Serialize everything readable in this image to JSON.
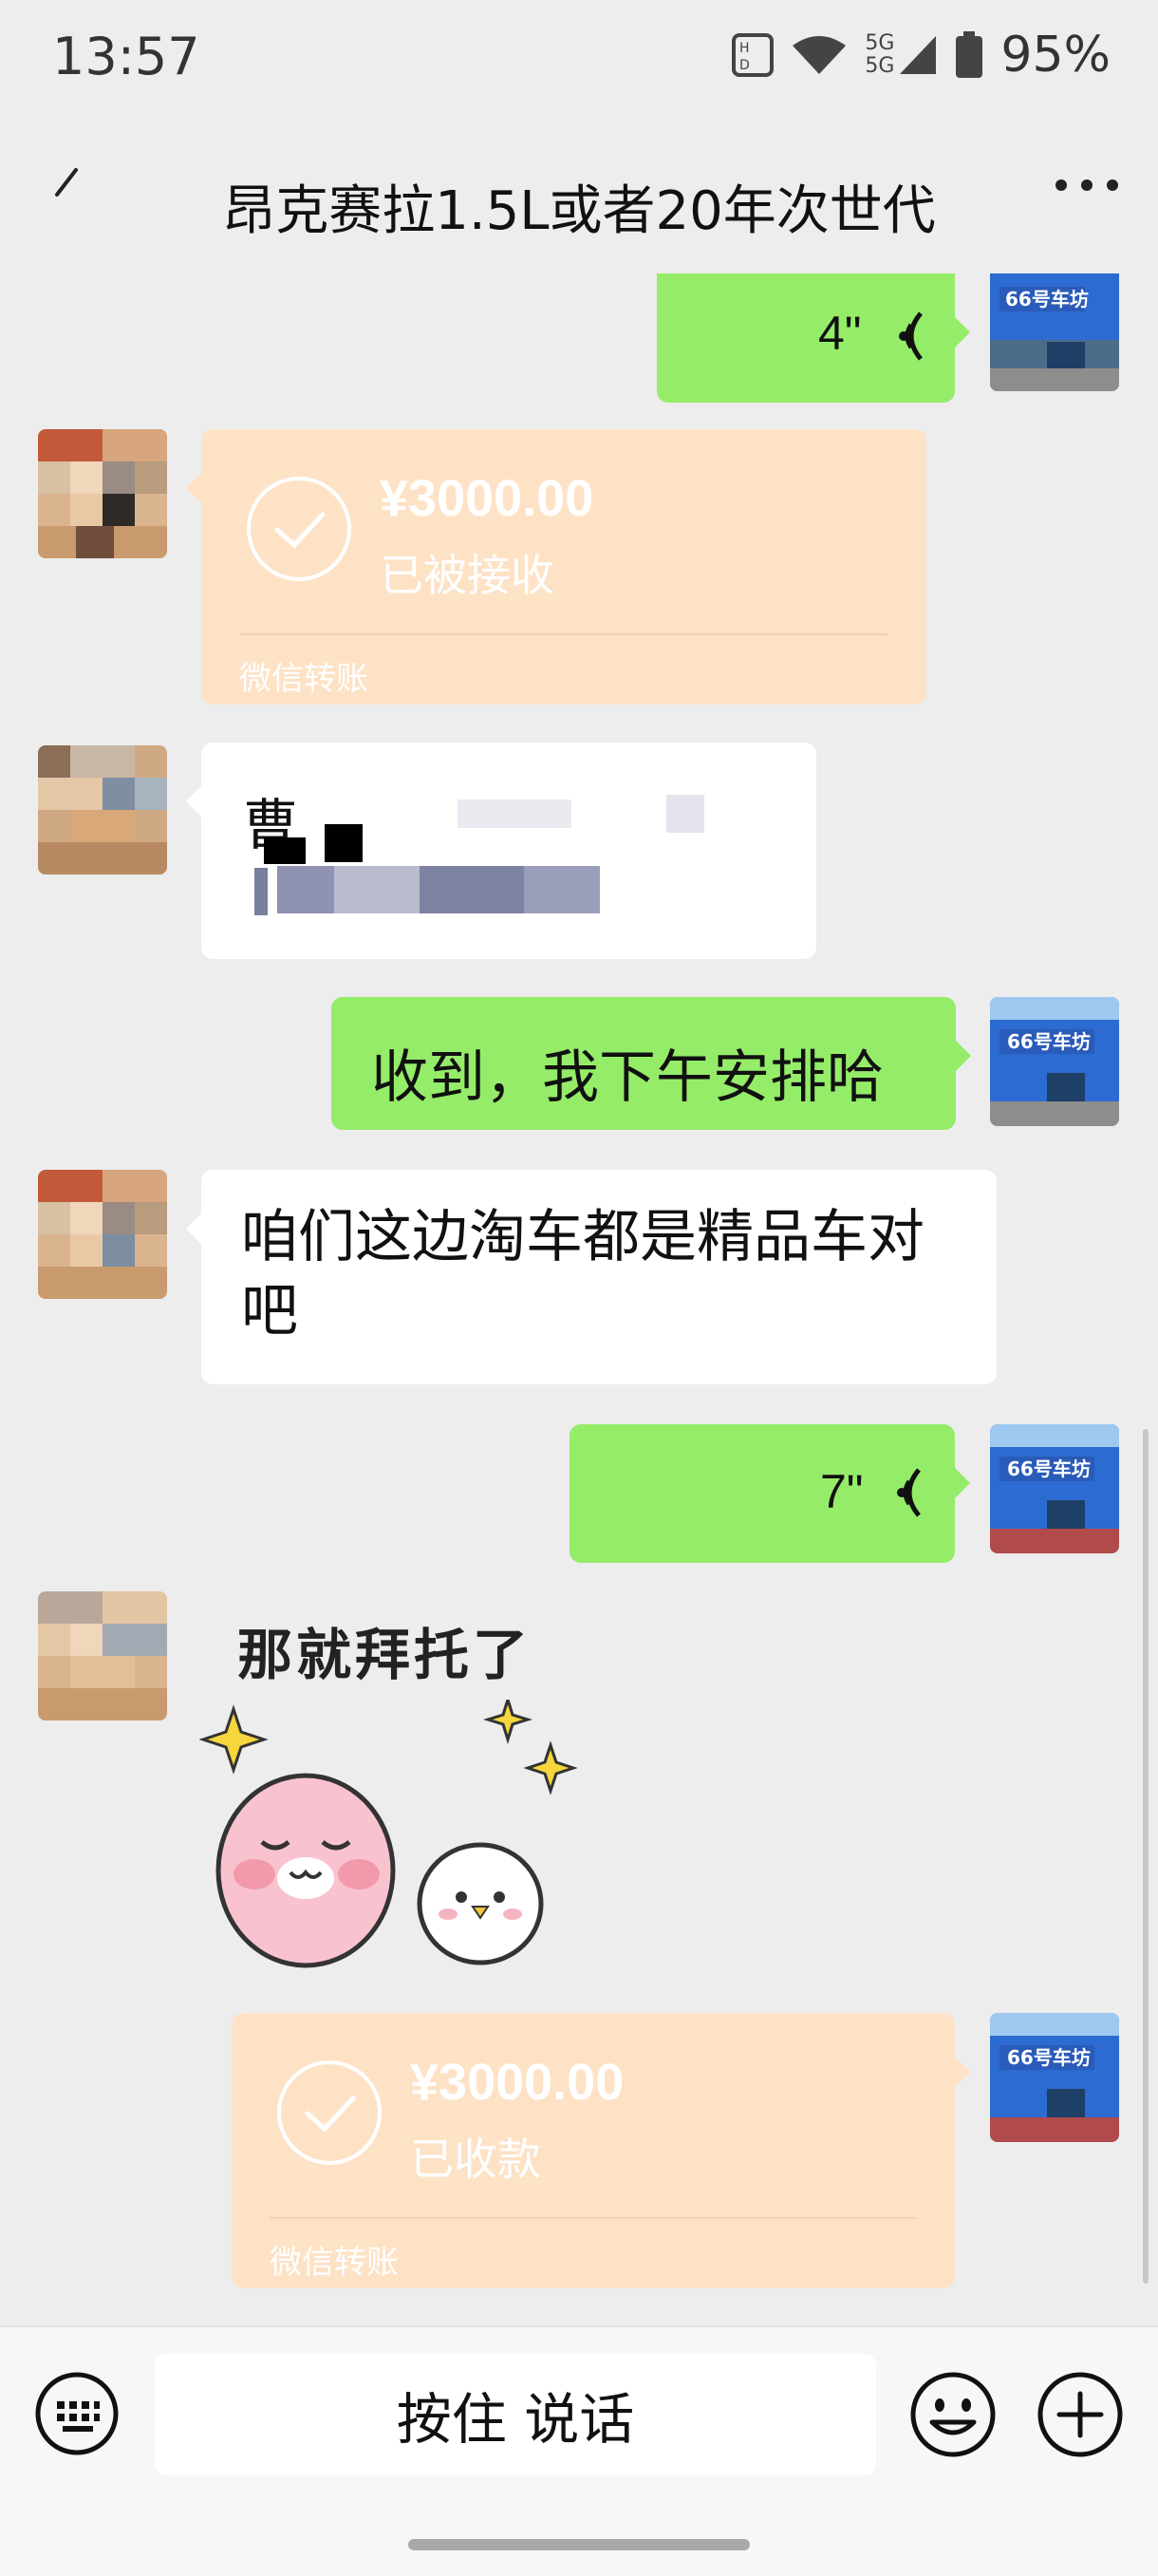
{
  "status_bar": {
    "time": "13:57",
    "network_label": "5G",
    "network_label_2": "5G",
    "battery": "95%"
  },
  "header": {
    "title": "昂克赛拉1.5L或者20年次世代",
    "back_icon": "back-arrow-icon",
    "more_icon": "more-dots-icon"
  },
  "messages": [
    {
      "type": "voice",
      "side": "right",
      "duration": "4\""
    },
    {
      "type": "transfer",
      "side": "left",
      "amount": "¥3000.00",
      "status": "已被接收",
      "footer": "微信转账"
    },
    {
      "type": "text",
      "side": "left",
      "text": "曹",
      "note_visible": "obscured"
    },
    {
      "type": "text",
      "side": "right",
      "text": "收到，我下午安排哈"
    },
    {
      "type": "text",
      "side": "left",
      "text": "咱们这边淘车都是精品车对吧"
    },
    {
      "type": "voice",
      "side": "right",
      "duration": "7\""
    },
    {
      "type": "sticker",
      "side": "left",
      "text": "那就拜托了"
    },
    {
      "type": "transfer",
      "side": "right",
      "amount": "¥3000.00",
      "status": "已收款",
      "footer": "微信转账"
    }
  ],
  "input_bar": {
    "hold_to_talk": "按住 说话",
    "keyboard_icon": "keyboard-icon",
    "emoji_icon": "emoji-icon",
    "plus_icon": "plus-icon"
  },
  "colors": {
    "background": "#ededed",
    "my_bubble": "#95ec69",
    "their_bubble": "#ffffff",
    "transfer_card": "#fde2c6"
  }
}
